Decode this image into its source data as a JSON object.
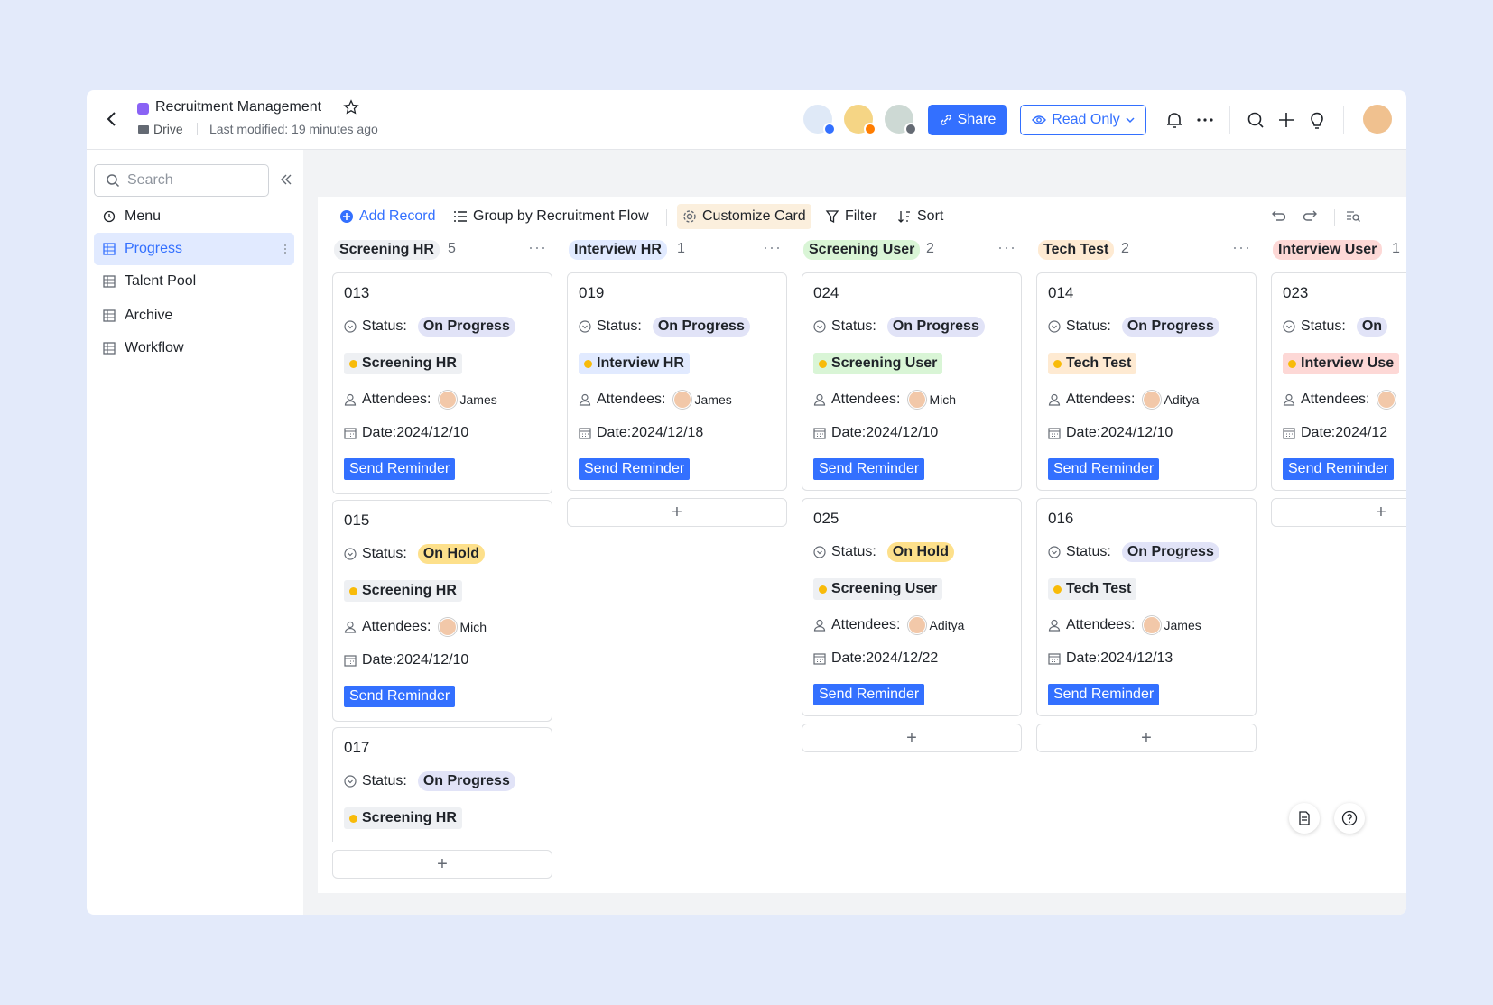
{
  "header": {
    "title": "Recruitment Management",
    "location": "Drive",
    "last_modified": "Last modified: 19 minutes ago",
    "share_label": "Share",
    "read_only_label": "Read Only"
  },
  "sidebar": {
    "search_placeholder": "Search",
    "menu_label": "Menu",
    "items": [
      {
        "label": "Progress",
        "active": true
      },
      {
        "label": "Talent Pool",
        "active": false
      },
      {
        "label": "Archive",
        "active": false
      },
      {
        "label": "Workflow",
        "active": false
      }
    ]
  },
  "toolbar": {
    "add_record": "Add Record",
    "group_by": "Group by Recruitment Flow",
    "customize": "Customize Card",
    "filter": "Filter",
    "sort": "Sort"
  },
  "labels": {
    "status": "Status",
    "attendees": "Attendees:",
    "date_prefix": "Date: ",
    "send_reminder": "Send Reminder",
    "add": "+"
  },
  "colors": {
    "accent": "#3370ff",
    "screening_hr": "#eef0f3",
    "interview_hr": "#e1eaff",
    "screening_user": "#d9f5d6",
    "tech_test": "#feead2",
    "interview_user": "#fdd8d6",
    "on_progress": "#e1e3f7",
    "on_hold": "#fde08b"
  },
  "columns": [
    {
      "name": "Screening HR",
      "count": "5",
      "cards": [
        {
          "id": "013",
          "status": "On Progress",
          "stage": "Screening HR",
          "attendee": "James",
          "date": "2024/12/10"
        },
        {
          "id": "015",
          "status": "On Hold",
          "stage": "Screening HR",
          "attendee": "Mich",
          "date": "2024/12/10"
        },
        {
          "id": "017",
          "status": "On Progress",
          "stage": "Screening HR"
        }
      ]
    },
    {
      "name": "Interview HR",
      "count": "1",
      "cards": [
        {
          "id": "019",
          "status": "On Progress",
          "stage": "Interview HR",
          "attendee": "James",
          "date": "2024/12/18"
        }
      ]
    },
    {
      "name": "Screening User",
      "count": "2",
      "cards": [
        {
          "id": "024",
          "status": "On Progress",
          "stage": "Screening User",
          "attendee": "Mich",
          "date": "2024/12/10"
        },
        {
          "id": "025",
          "status": "On Hold",
          "stage": "Screening User",
          "attendee": "Aditya",
          "date": "2024/12/22"
        }
      ]
    },
    {
      "name": "Tech Test",
      "count": "2",
      "cards": [
        {
          "id": "014",
          "status": "On Progress",
          "stage": "Tech Test",
          "attendee": "Aditya",
          "date": "2024/12/10"
        },
        {
          "id": "016",
          "status": "On Progress",
          "stage": "Tech Test",
          "attendee": "James",
          "date": "2024/12/13"
        }
      ]
    },
    {
      "name": "Interview User",
      "count": "1",
      "cards": [
        {
          "id": "023",
          "status": "On",
          "stage": "Interview Use",
          "date": "2024/12"
        }
      ]
    }
  ]
}
